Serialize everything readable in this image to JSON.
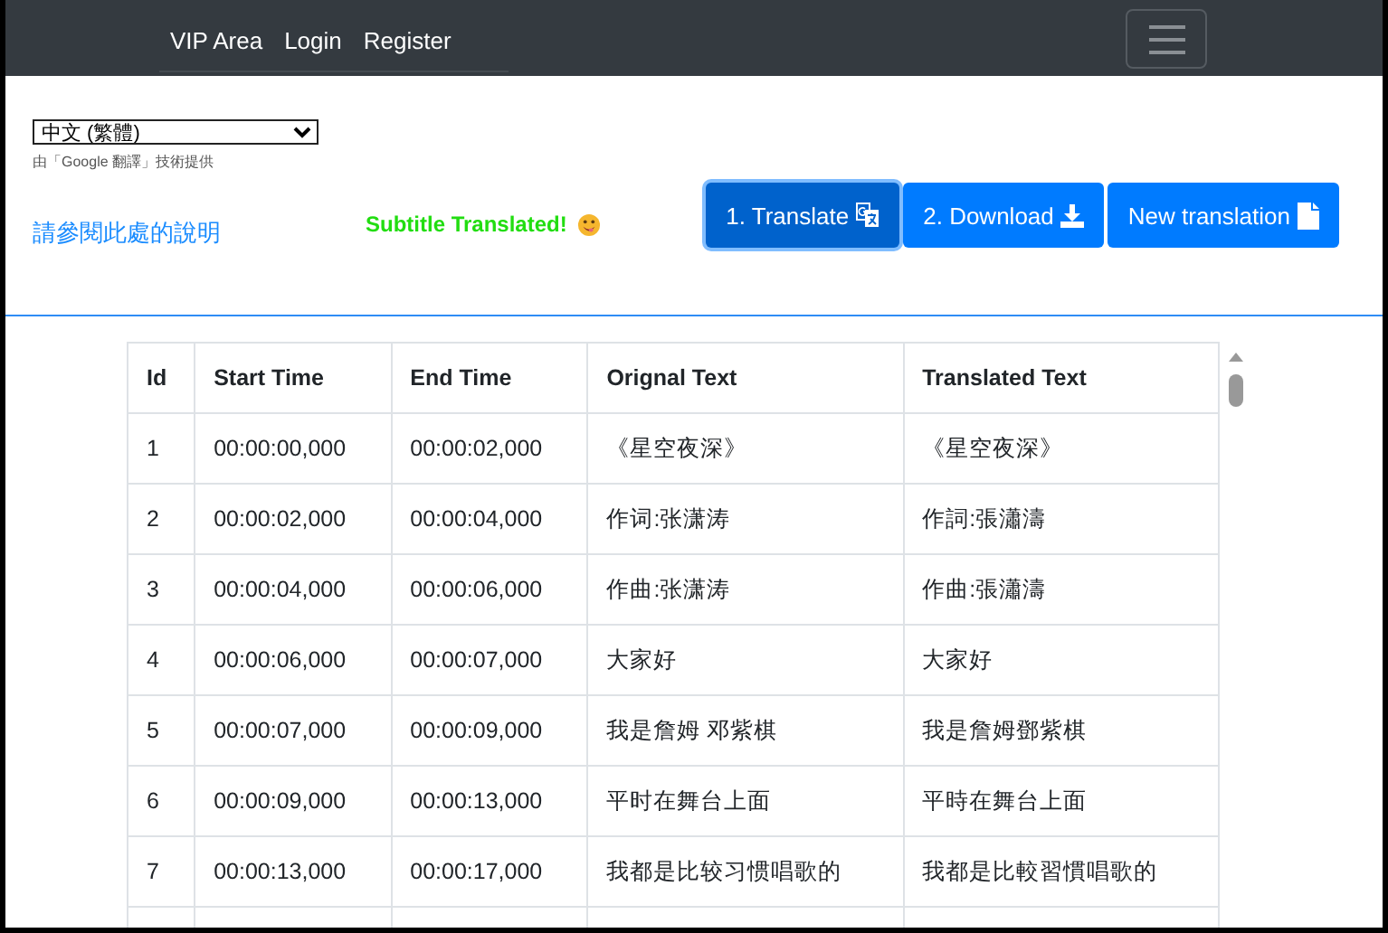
{
  "navbar": {
    "links": [
      "VIP Area",
      "Login",
      "Register"
    ]
  },
  "language_select": {
    "value": "中文 (繁體)"
  },
  "attribution": "由「Google 翻譯」技術提供",
  "help_link": "請參閱此處的說明",
  "status": "Subtitle Translated!",
  "buttons": [
    {
      "label": "1. Translate",
      "kind": "translate",
      "selected": true
    },
    {
      "label": "2. Download",
      "kind": "download",
      "selected": false
    },
    {
      "label": "New translation",
      "kind": "new",
      "selected": false
    }
  ],
  "table": {
    "columns": [
      "Id",
      "Start Time",
      "End Time",
      "Orignal Text",
      "Translated Text"
    ],
    "rows": [
      [
        "1",
        "00:00:00,000",
        "00:00:02,000",
        "《星空夜深》",
        "《星空夜深》"
      ],
      [
        "2",
        "00:00:02,000",
        "00:00:04,000",
        "作词:张潇涛",
        "作詞:張瀟濤"
      ],
      [
        "3",
        "00:00:04,000",
        "00:00:06,000",
        "作曲:张潇涛",
        "作曲:張瀟濤"
      ],
      [
        "4",
        "00:00:06,000",
        "00:00:07,000",
        "大家好",
        "大家好"
      ],
      [
        "5",
        "00:00:07,000",
        "00:00:09,000",
        "我是詹姆 邓紫棋",
        "我是詹姆鄧紫棋"
      ],
      [
        "6",
        "00:00:09,000",
        "00:00:13,000",
        "平时在舞台上面",
        "平時在舞台上面"
      ],
      [
        "7",
        "00:00:13,000",
        "00:00:17,000",
        "我都是比较习惯唱歌的",
        "我都是比較習慣唱歌的"
      ]
    ]
  }
}
